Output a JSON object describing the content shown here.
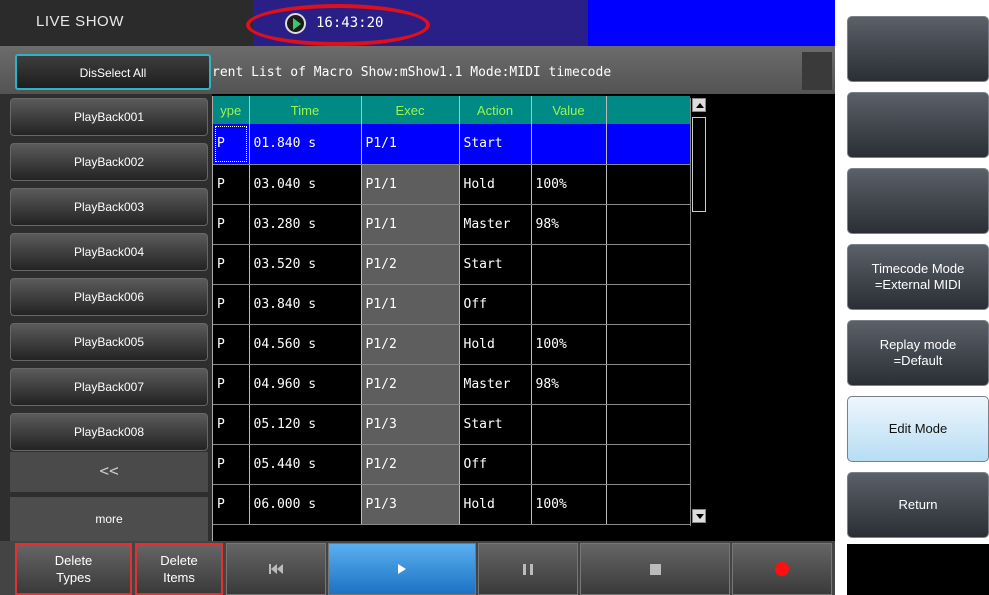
{
  "title_bar": {
    "title": "LIVE SHOW",
    "clock": "16:43:20"
  },
  "info_bar": {
    "deselect_label": "DisSelect All",
    "list_info": "rent List of Macro Show:mShow1.1  Mode:MIDI timecode"
  },
  "playbacks": [
    "PlayBack001",
    "PlayBack002",
    "PlayBack003",
    "PlayBack004",
    "PlayBack006",
    "PlayBack005",
    "PlayBack007",
    "PlayBack008"
  ],
  "left_nav": {
    "prev_label": "<<",
    "more_label": "more"
  },
  "table": {
    "headers": [
      "ype",
      "Time",
      "Exec",
      "Action",
      "Value"
    ],
    "rows": [
      [
        "P",
        "01.840 s",
        "P1/1",
        "Start",
        ""
      ],
      [
        "P",
        "03.040 s",
        "P1/1",
        "Hold",
        "100%"
      ],
      [
        "P",
        "03.280 s",
        "P1/1",
        "Master",
        "98%"
      ],
      [
        "P",
        "03.520 s",
        "P1/2",
        "Start",
        ""
      ],
      [
        "P",
        "03.840 s",
        "P1/1",
        "Off",
        ""
      ],
      [
        "P",
        "04.560 s",
        "P1/2",
        "Hold",
        "100%"
      ],
      [
        "P",
        "04.960 s",
        "P1/2",
        "Master",
        "98%"
      ],
      [
        "P",
        "05.120 s",
        "P1/3",
        "Start",
        ""
      ],
      [
        "P",
        "05.440 s",
        "P1/2",
        "Off",
        ""
      ],
      [
        "P",
        "06.000 s",
        "P1/3",
        "Hold",
        "100%"
      ]
    ],
    "selected_row": 0
  },
  "right_buttons": {
    "timecode_l1": "Timecode Mode",
    "timecode_l2": "=External MIDI",
    "replay_l1": "Replay mode",
    "replay_l2": "=Default",
    "edit": "Edit Mode",
    "return": "Return"
  },
  "bottom_bar": {
    "delete_types_l1": "Delete",
    "delete_types_l2": "Types",
    "delete_items_l1": "Delete",
    "delete_items_l2": "Items",
    "icons": [
      "skip-back-icon",
      "play-icon",
      "pause-icon",
      "stop-icon",
      "record-icon"
    ]
  },
  "colors": {
    "header_bg": "#008a86",
    "header_text": "#9ff54b",
    "selected_row": "#0000ff",
    "accent_red": "#e0101a",
    "active_button": "#cfe9f9"
  }
}
